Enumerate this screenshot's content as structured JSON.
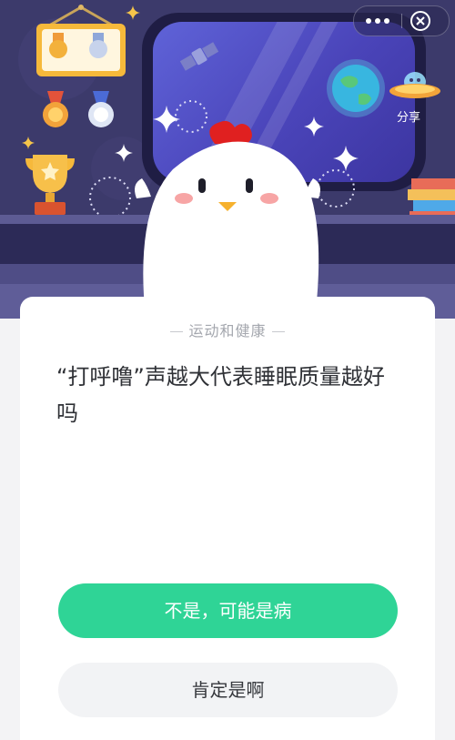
{
  "header": {
    "menu_icon": "more-dots-icon",
    "close_icon": "close-circle-icon",
    "share_label": "分享"
  },
  "quiz": {
    "category": "运动和健康",
    "question": "“打呼噜”声越大代表睡眠质量越好吗",
    "options": [
      {
        "label": "不是，可能是病",
        "style": "primary"
      },
      {
        "label": "肯定是啊",
        "style": "secondary"
      }
    ]
  },
  "colors": {
    "scene_background": "#3c3a6b",
    "window_glass": "#4a44b9",
    "primary_button": "#2fd496",
    "secondary_button": "#f2f3f5",
    "category_text": "#a4a7ae",
    "question_text": "#2f3136"
  }
}
